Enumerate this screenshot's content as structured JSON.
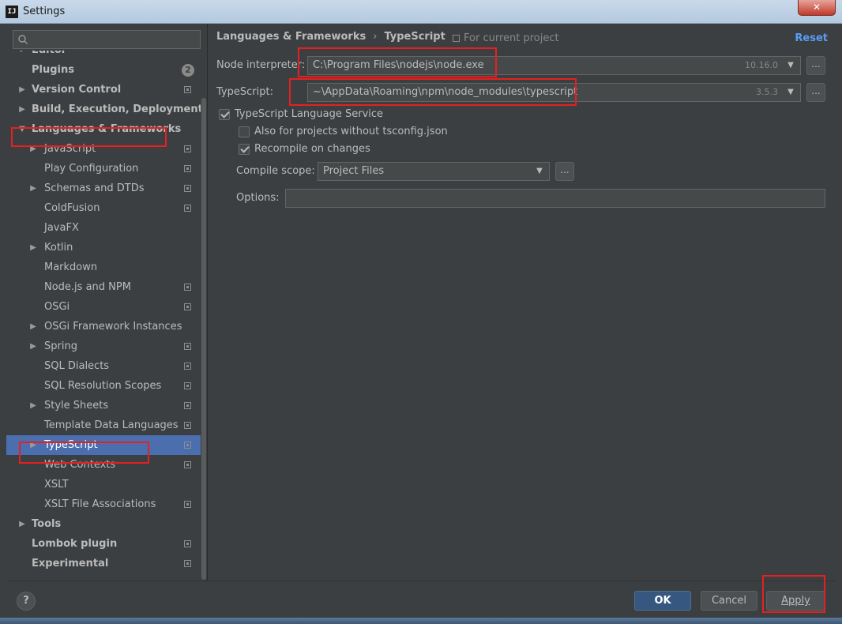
{
  "window": {
    "title": "Settings",
    "app_icon_text": "IJ",
    "close_glyph": "✕"
  },
  "sidebar": {
    "search_placeholder": "",
    "items": [
      {
        "label": "Editor",
        "level": 0,
        "bold": true,
        "arrow": "▸",
        "project": false,
        "partial": true
      },
      {
        "label": "Plugins",
        "level": 0,
        "bold": true,
        "arrow": "",
        "project": false,
        "badge": "2"
      },
      {
        "label": "Version Control",
        "level": 0,
        "bold": true,
        "arrow": "▶",
        "project": true
      },
      {
        "label": "Build, Execution, Deployment",
        "level": 0,
        "bold": true,
        "arrow": "▶",
        "project": false
      },
      {
        "label": "Languages & Frameworks",
        "level": 0,
        "bold": true,
        "arrow": "▼",
        "project": false
      },
      {
        "label": "JavaScript",
        "level": 1,
        "bold": false,
        "arrow": "▶",
        "project": true
      },
      {
        "label": "Play Configuration",
        "level": 1,
        "bold": false,
        "arrow": "",
        "project": true
      },
      {
        "label": "Schemas and DTDs",
        "level": 1,
        "bold": false,
        "arrow": "▶",
        "project": true
      },
      {
        "label": "ColdFusion",
        "level": 1,
        "bold": false,
        "arrow": "",
        "project": true
      },
      {
        "label": "JavaFX",
        "level": 1,
        "bold": false,
        "arrow": "",
        "project": false
      },
      {
        "label": "Kotlin",
        "level": 1,
        "bold": false,
        "arrow": "▶",
        "project": false
      },
      {
        "label": "Markdown",
        "level": 1,
        "bold": false,
        "arrow": "",
        "project": false
      },
      {
        "label": "Node.js and NPM",
        "level": 1,
        "bold": false,
        "arrow": "",
        "project": true
      },
      {
        "label": "OSGi",
        "level": 1,
        "bold": false,
        "arrow": "",
        "project": true
      },
      {
        "label": "OSGi Framework Instances",
        "level": 1,
        "bold": false,
        "arrow": "▶",
        "project": false
      },
      {
        "label": "Spring",
        "level": 1,
        "bold": false,
        "arrow": "▶",
        "project": true
      },
      {
        "label": "SQL Dialects",
        "level": 1,
        "bold": false,
        "arrow": "",
        "project": true
      },
      {
        "label": "SQL Resolution Scopes",
        "level": 1,
        "bold": false,
        "arrow": "",
        "project": true
      },
      {
        "label": "Style Sheets",
        "level": 1,
        "bold": false,
        "arrow": "▶",
        "project": true
      },
      {
        "label": "Template Data Languages",
        "level": 1,
        "bold": false,
        "arrow": "",
        "project": true
      },
      {
        "label": "TypeScript",
        "level": 1,
        "bold": false,
        "arrow": "▶",
        "project": true,
        "selected": true
      },
      {
        "label": "Web Contexts",
        "level": 1,
        "bold": false,
        "arrow": "",
        "project": true
      },
      {
        "label": "XSLT",
        "level": 1,
        "bold": false,
        "arrow": "",
        "project": false
      },
      {
        "label": "XSLT File Associations",
        "level": 1,
        "bold": false,
        "arrow": "",
        "project": true
      },
      {
        "label": "Tools",
        "level": 0,
        "bold": true,
        "arrow": "▶",
        "project": false
      },
      {
        "label": "Lombok plugin",
        "level": 0,
        "bold": true,
        "arrow": "",
        "project": true
      },
      {
        "label": "Experimental",
        "level": 0,
        "bold": true,
        "arrow": "",
        "project": true
      }
    ]
  },
  "panel": {
    "breadcrumb": [
      "Languages & Frameworks",
      "TypeScript"
    ],
    "breadcrumb_sep": "›",
    "for_project": "For current project",
    "reset": "Reset",
    "node_label": "Node interpreter:",
    "node_value": "C:\\Program Files\\nodejs\\node.exe",
    "node_version": "10.16.0",
    "ts_label": "TypeScript:",
    "ts_value": "~\\AppData\\Roaming\\npm\\node_modules\\typescript",
    "ts_version": "3.5.3",
    "service_label": "TypeScript Language Service",
    "service_checked": true,
    "also_label": "Also for projects without tsconfig.json",
    "also_checked": false,
    "recompile_label": "Recompile on changes",
    "recompile_checked": true,
    "scope_label": "Compile scope:",
    "scope_value": "Project Files",
    "options_label": "Options:",
    "options_value": "",
    "more": "...",
    "dropdown_glyph": "▼"
  },
  "buttons": {
    "help": "?",
    "ok": "OK",
    "cancel": "Cancel",
    "apply": "Apply"
  },
  "colors": {
    "background": "#3c3f41",
    "selection": "#4b6eaf",
    "link": "#589df6",
    "annotation": "#e52020",
    "ok_button": "#365880"
  }
}
